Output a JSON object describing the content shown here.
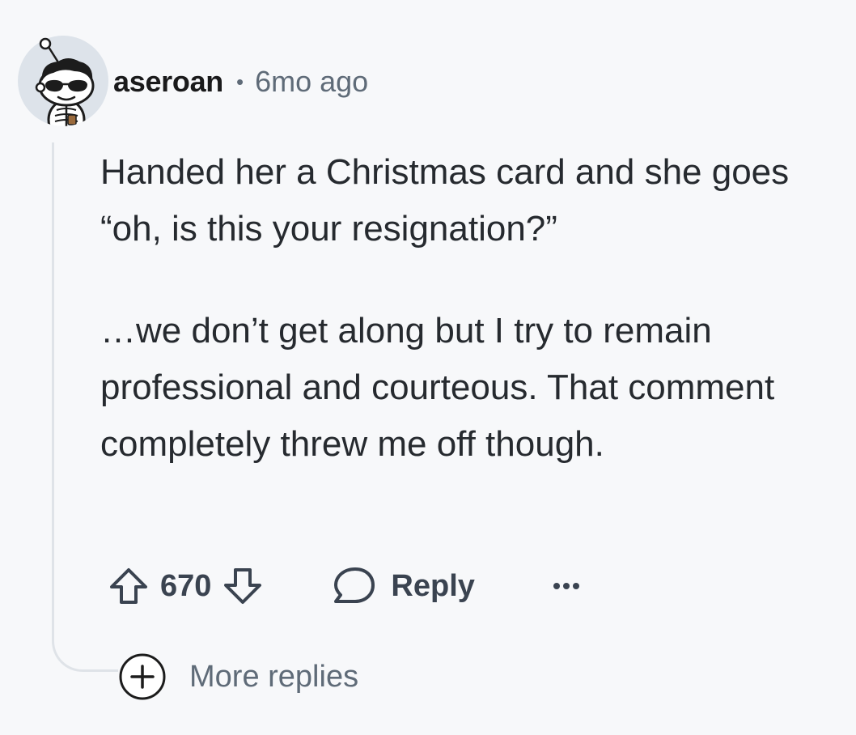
{
  "comment": {
    "username": "aseroan",
    "separator": "•",
    "timestamp": "6mo ago",
    "avatar_icon": "snoo-avatar-sunglasses-icon",
    "paragraphs": [
      "Handed her a Christmas card and she goes “oh, is this your resignation?”",
      "…we don’t get along but I try to remain professional and courteous. That comment completely threw me off though."
    ]
  },
  "actions": {
    "upvote_icon": "upvote-arrow-icon",
    "score": "670",
    "downvote_icon": "downvote-arrow-icon",
    "reply_icon": "speech-bubble-icon",
    "reply_label": "Reply",
    "more_icon": "ellipsis-icon"
  },
  "more_replies": {
    "icon": "plus-circle-icon",
    "label": "More replies"
  },
  "colors": {
    "background": "#f7f8fa",
    "text_primary": "#262a2f",
    "text_secondary": "#5f6b78",
    "thread_line": "#dfe3e8"
  }
}
